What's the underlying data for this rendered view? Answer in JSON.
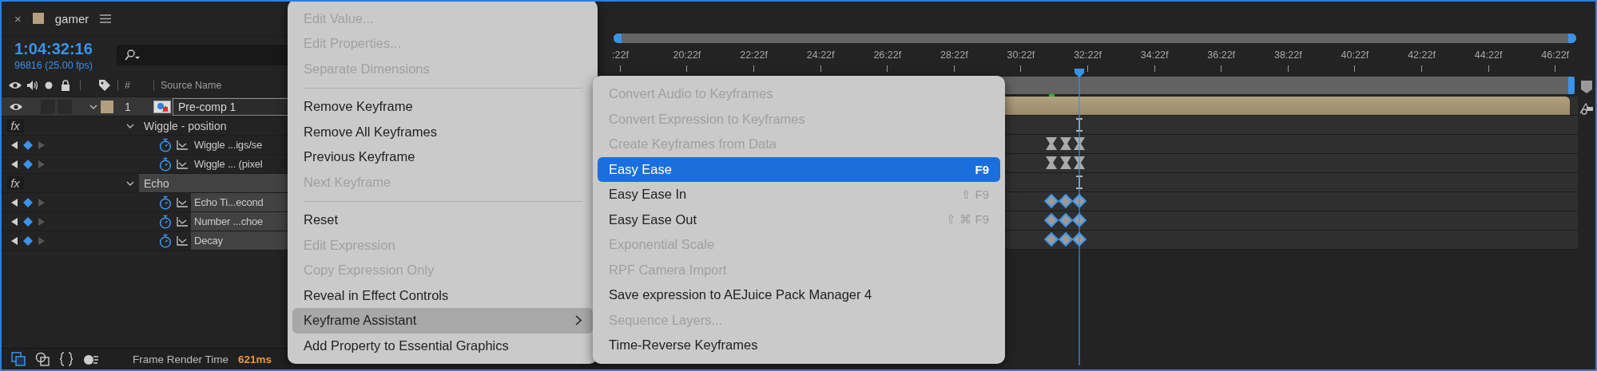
{
  "panel": {
    "close": "×",
    "title": "gamer",
    "time": "1:04:32:16",
    "frames": "96816 (25.00 fps)",
    "columns": [
      "#",
      "Source Name"
    ]
  },
  "layers": [
    {
      "number": "1",
      "name": "Pre-comp 1",
      "selected": true,
      "children": [
        {
          "badge": "fx",
          "name": "Wiggle - position",
          "selected": false,
          "children": [
            {
              "name": "Wiggle ...igs/se",
              "selected": false
            },
            {
              "name": "Wiggle ... (pixel",
              "selected": false
            }
          ]
        },
        {
          "badge": "fx",
          "name": "Echo",
          "selected": true,
          "children": [
            {
              "name": "Echo Ti...econd",
              "selected": true
            },
            {
              "name": "Number ...choe",
              "selected": true
            },
            {
              "name": "Decay",
              "selected": true
            }
          ]
        }
      ]
    }
  ],
  "timeline": {
    "ruler": [
      ":22f",
      "20:22f",
      "22:22f",
      "24:22f",
      "26:22f",
      "28:22f",
      "30:22f",
      "32:22f",
      "34:22f",
      "36:22f",
      "38:22f",
      "40:22f",
      "42:22f",
      "44:22f",
      "46:22f"
    ],
    "tracks": [
      {
        "kind": "bar"
      },
      {
        "kind": "ibeam"
      },
      {
        "kind": "hourglass"
      },
      {
        "kind": "hourglass"
      },
      {
        "kind": "ibeam"
      },
      {
        "kind": "diamond"
      },
      {
        "kind": "diamond"
      },
      {
        "kind": "diamond"
      }
    ]
  },
  "status_bar": {
    "label": "Frame Render Time",
    "value": "621ms"
  },
  "context_menu": {
    "items": [
      {
        "kind": "item",
        "label": "Edit Value...",
        "disabled": true,
        "selected": false
      },
      {
        "kind": "item",
        "label": "Edit Properties...",
        "disabled": true,
        "selected": false
      },
      {
        "kind": "item",
        "label": "Separate Dimensions",
        "disabled": true,
        "selected": false
      },
      {
        "kind": "separator"
      },
      {
        "kind": "item",
        "label": "Remove Keyframe",
        "disabled": false,
        "selected": false
      },
      {
        "kind": "item",
        "label": "Remove All Keyframes",
        "disabled": false,
        "selected": false
      },
      {
        "kind": "item",
        "label": "Previous Keyframe",
        "disabled": false,
        "selected": false
      },
      {
        "kind": "item",
        "label": "Next Keyframe",
        "disabled": true,
        "selected": false
      },
      {
        "kind": "separator"
      },
      {
        "kind": "item",
        "label": "Reset",
        "disabled": false,
        "selected": false
      },
      {
        "kind": "item",
        "label": "Edit Expression",
        "disabled": true,
        "selected": false
      },
      {
        "kind": "item",
        "label": "Copy Expression Only",
        "disabled": true,
        "selected": false
      },
      {
        "kind": "item",
        "label": "Reveal in Effect Controls",
        "disabled": false,
        "selected": false
      },
      {
        "kind": "submenu",
        "label": "Keyframe Assistant",
        "disabled": false,
        "selected": true
      },
      {
        "kind": "item",
        "label": "Add Property to Essential Graphics",
        "disabled": false,
        "selected": false
      }
    ]
  },
  "submenu": {
    "items": [
      {
        "label": "Convert Audio to Keyframes",
        "disabled": true,
        "selected": false
      },
      {
        "label": "Convert Expression to Keyframes",
        "disabled": true,
        "selected": false
      },
      {
        "label": "Create Keyframes from Data",
        "disabled": true,
        "selected": false
      },
      {
        "label": "Easy Ease",
        "shortcut": "F9",
        "disabled": false,
        "selected": true
      },
      {
        "label": "Easy Ease In",
        "shortcut": "⇧ F9",
        "disabled": false,
        "selected": false
      },
      {
        "label": "Easy Ease Out",
        "shortcut": "⇧ ⌘ F9",
        "disabled": false,
        "selected": false
      },
      {
        "label": "Exponential Scale",
        "disabled": true,
        "selected": false
      },
      {
        "label": "RPF Camera Import",
        "disabled": true,
        "selected": false
      },
      {
        "label": "Save expression to AEJuice Pack Manager 4",
        "disabled": false,
        "selected": false
      },
      {
        "label": "Sequence Layers...",
        "disabled": true,
        "selected": false
      },
      {
        "label": "Time-Reverse Keyframes",
        "disabled": false,
        "selected": false
      }
    ]
  }
}
